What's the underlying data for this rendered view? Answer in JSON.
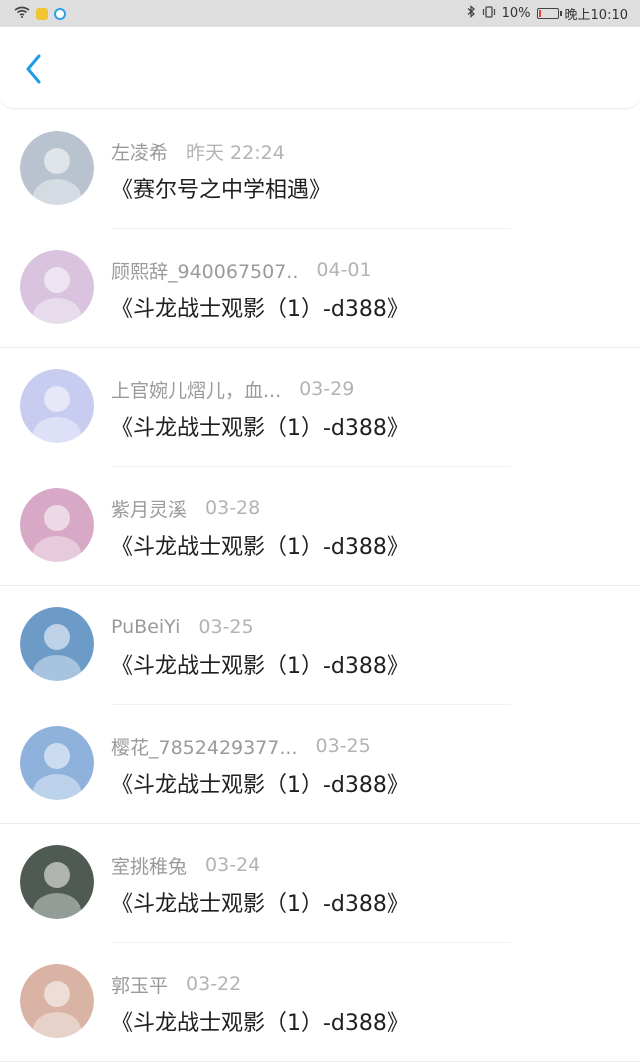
{
  "status_bar": {
    "battery": "10%",
    "time": "晚上10:10",
    "battery_level": 0.1,
    "icons": [
      "wifi-icon",
      "app-icon-1",
      "app-icon-2",
      "bluetooth-icon",
      "vibrate-icon",
      "battery-icon"
    ]
  },
  "header": {
    "back_icon": "chevron-left-icon",
    "accent_color": "#1e9be8"
  },
  "items": [
    {
      "name": "左凌希",
      "date": "昨天 22:24",
      "title": "《赛尔号之中学相遇》",
      "avatar_color": "#b8c3cf"
    },
    {
      "name": "顾熙辞_940067507..",
      "date": "04-01",
      "title": "《斗龙战士观影（1）-d388》",
      "avatar_color": "#d9c3df"
    },
    {
      "name": "上官婉儿熠儿，血...",
      "date": "03-29",
      "title": "《斗龙战士观影（1）-d388》",
      "avatar_color": "#c7ccf0"
    },
    {
      "name": "紫月灵溪",
      "date": "03-28",
      "title": "《斗龙战士观影（1）-d388》",
      "avatar_color": "#d8a9c6"
    },
    {
      "name": "PuBeiYi",
      "date": "03-25",
      "title": "《斗龙战士观影（1）-d388》",
      "avatar_color": "#6d9bc7"
    },
    {
      "name": "樱花_7852429377...",
      "date": "03-25",
      "title": "《斗龙战士观影（1）-d388》",
      "avatar_color": "#8fb2dd"
    },
    {
      "name": "室挑稚兔",
      "date": "03-24",
      "title": "《斗龙战士观影（1）-d388》",
      "avatar_color": "#4e5a52"
    },
    {
      "name": "郭玉平",
      "date": "03-22",
      "title": "《斗龙战士观影（1）-d388》",
      "avatar_color": "#d9b3a4"
    }
  ]
}
